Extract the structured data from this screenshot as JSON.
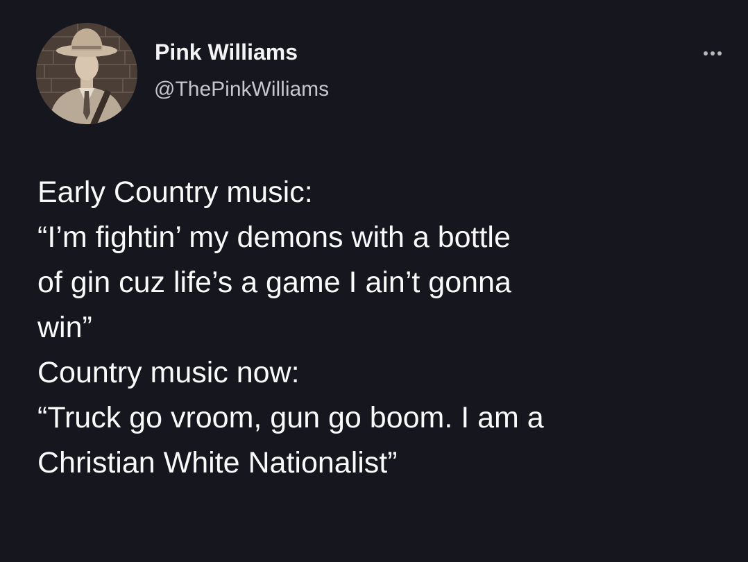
{
  "tweet": {
    "author": {
      "display_name": "Pink Williams",
      "handle": "@ThePinkWilliams",
      "avatar_icon": "avatar-photo-cowboy-hat"
    },
    "more_icon": "more-horizontal-icon",
    "text_lines": [
      "Early Country music:",
      "“I’m fightin’ my demons with a bottle",
      "of gin cuz life’s a game I ain’t gonna",
      "win”",
      "Country music now:",
      "“Truck go vroom, gun go boom. I am a",
      "Christian White Nationalist”"
    ]
  },
  "colors": {
    "background": "#16161f",
    "text": "#fafafa",
    "handle": "#c6c6cc",
    "more_dots": "#b7b7bc"
  }
}
